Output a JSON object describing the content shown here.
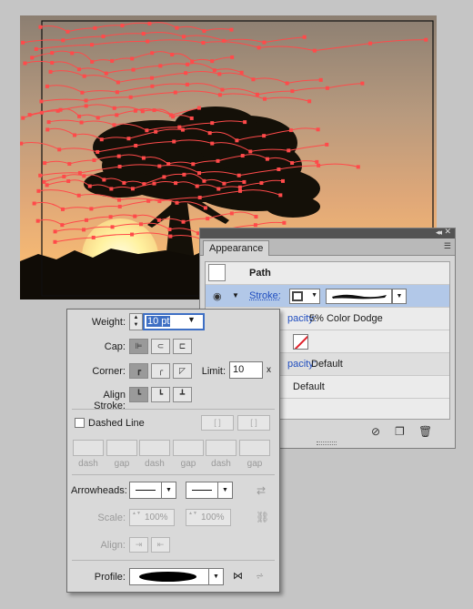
{
  "appearance": {
    "tab_label": "Appearance",
    "object_label": "Path",
    "stroke_label": "Stroke:",
    "opacity1_value": "5% Color Dodge",
    "opacity1_link": "pacity:",
    "opacity2_link": "pacity:",
    "opacity2_value": "Default",
    "opacity3_value": "Default"
  },
  "stroke": {
    "weight_label": "Weight:",
    "weight_value": "10 pt",
    "cap_label": "Cap:",
    "corner_label": "Corner:",
    "limit_label": "Limit:",
    "limit_value": "10",
    "limit_unit": "x",
    "align_label": "Align Stroke:",
    "dashed_label": "Dashed Line",
    "dash_labels": [
      "dash",
      "gap",
      "dash",
      "gap",
      "dash",
      "gap"
    ],
    "arrowheads_label": "Arrowheads:",
    "scale_label": "Scale:",
    "scale_start": "100%",
    "scale_end": "100%",
    "align_arrow_label": "Align:",
    "profile_label": "Profile:"
  },
  "colors": {
    "path_color": "#ff4a4a",
    "selection_blue": "#b2c8e8",
    "link_blue": "#1f4dbf"
  },
  "icons": [
    "eye-icon",
    "expand-triangle-icon",
    "clear-appearance-icon",
    "duplicate-item-icon",
    "delete-item-icon",
    "panel-menu-icon",
    "swap-arrowheads-icon",
    "link-scale-icon",
    "flip-profile-horizontal-icon",
    "flip-profile-vertical-icon"
  ]
}
